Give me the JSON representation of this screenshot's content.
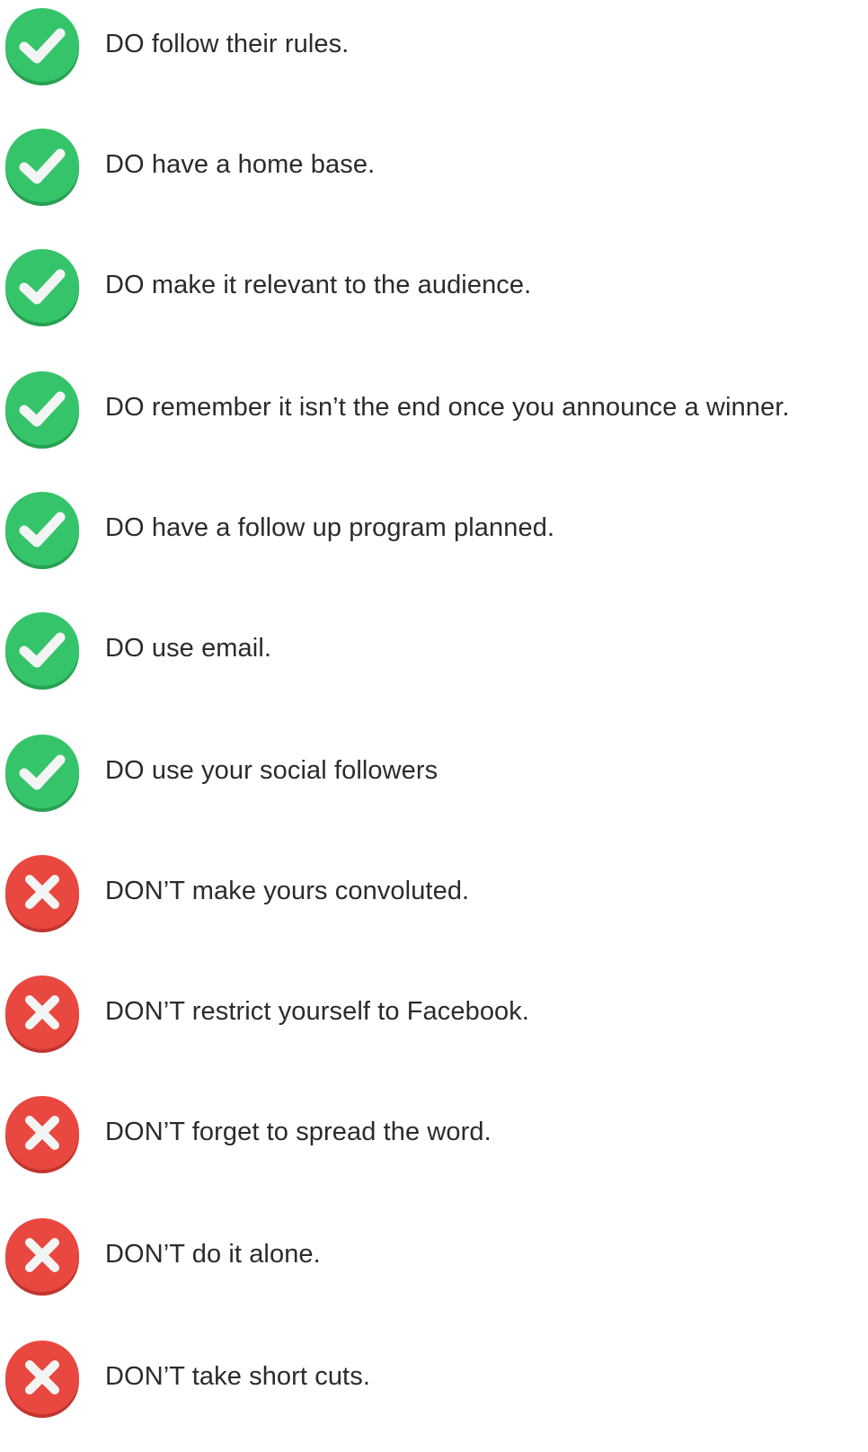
{
  "colors": {
    "do_main": "#35c46a",
    "do_shadow": "#27a152",
    "dont_main": "#e8483f",
    "dont_shadow": "#c2352f",
    "mark": "#f3f5f5",
    "text": "#2b2b2b"
  },
  "items": [
    {
      "kind": "do",
      "icon": "check-icon",
      "text": "DO follow their rules."
    },
    {
      "kind": "do",
      "icon": "check-icon",
      "text": "DO have a home base."
    },
    {
      "kind": "do",
      "icon": "check-icon",
      "text": "DO make it relevant to the audience."
    },
    {
      "kind": "do",
      "icon": "check-icon",
      "text": "DO remember it isn’t the end once you announce a winner."
    },
    {
      "kind": "do",
      "icon": "check-icon",
      "text": "DO have a follow up program planned."
    },
    {
      "kind": "do",
      "icon": "check-icon",
      "text": "DO use email."
    },
    {
      "kind": "do",
      "icon": "check-icon",
      "text": "DO use your social followers"
    },
    {
      "kind": "dont",
      "icon": "cross-icon",
      "text": "DON’T make yours convoluted."
    },
    {
      "kind": "dont",
      "icon": "cross-icon",
      "text": "DON’T restrict yourself to Facebook."
    },
    {
      "kind": "dont",
      "icon": "cross-icon",
      "text": "DON’T forget to spread the word."
    },
    {
      "kind": "dont",
      "icon": "cross-icon",
      "text": "DON’T do it alone."
    },
    {
      "kind": "dont",
      "icon": "cross-icon",
      "text": "DON’T take short cuts."
    }
  ]
}
